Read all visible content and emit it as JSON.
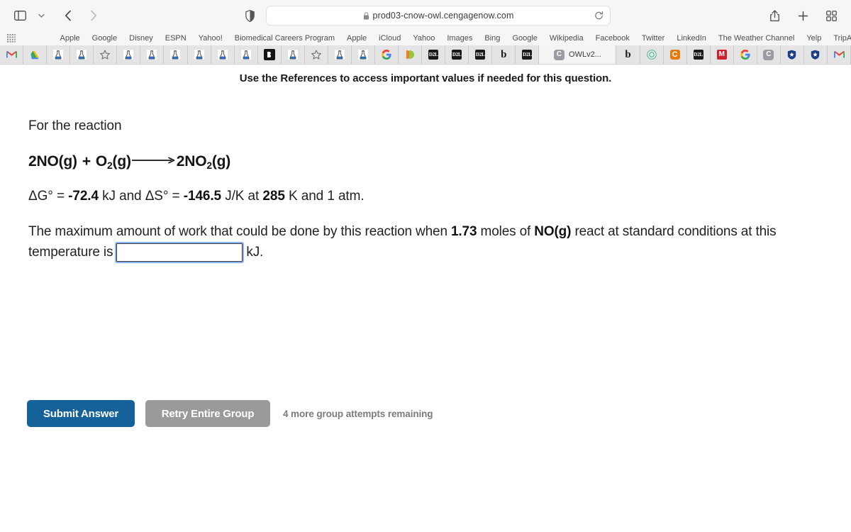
{
  "browser": {
    "toolbar": {
      "sidebar_toggle": "sidebar-toggle",
      "sidebar_chevron": "chevron-down",
      "back": "back-arrow",
      "forward": "forward-arrow",
      "shield": "privacy-shield",
      "url": "prod03-cnow-owl.cengagenow.com",
      "lock": "lock-icon",
      "reload": "reload-icon",
      "share": "share-icon",
      "new_tab": "plus-icon",
      "tab_overview": "tab-overview-icon"
    },
    "bookmarks": [
      "Apple",
      "Google",
      "Disney",
      "ESPN",
      "Yahoo!",
      "Biomedical Careers Program",
      "Apple",
      "iCloud",
      "Yahoo",
      "Images",
      "Bing",
      "Google",
      "Wikipedia",
      "Facebook",
      "Twitter",
      "LinkedIn",
      "The Weather Channel",
      "Yelp",
      "TripAdvisor"
    ],
    "tabs": [
      {
        "icon": "gmail-icon",
        "kind": "gmail",
        "label": "",
        "active": false
      },
      {
        "icon": "google-drive-icon",
        "kind": "drive",
        "label": "",
        "active": false
      },
      {
        "icon": "flask-icon",
        "kind": "flask",
        "label": "",
        "active": false
      },
      {
        "icon": "flask-icon",
        "kind": "flask",
        "label": "",
        "active": false
      },
      {
        "icon": "star-icon",
        "kind": "star",
        "label": "",
        "active": false
      },
      {
        "icon": "flask-icon",
        "kind": "flask",
        "label": "",
        "active": false
      },
      {
        "icon": "flask-icon",
        "kind": "flask",
        "label": "",
        "active": false
      },
      {
        "icon": "flask-icon",
        "kind": "flask",
        "label": "",
        "active": false
      },
      {
        "icon": "flask-icon",
        "kind": "flask",
        "label": "",
        "active": false
      },
      {
        "icon": "flask-icon",
        "kind": "flask",
        "label": "",
        "active": false
      },
      {
        "icon": "flask-icon",
        "kind": "flask",
        "label": "",
        "active": false
      },
      {
        "icon": "blackboard-icon",
        "kind": "blackboard",
        "label": "",
        "active": false
      },
      {
        "icon": "flask-icon",
        "kind": "flask",
        "label": "",
        "active": false
      },
      {
        "icon": "star-icon",
        "kind": "star",
        "label": "",
        "active": false
      },
      {
        "icon": "flask-icon",
        "kind": "flask",
        "label": "",
        "active": false
      },
      {
        "icon": "flask-icon",
        "kind": "flask",
        "label": "",
        "active": false
      },
      {
        "icon": "google-icon",
        "kind": "google",
        "label": "",
        "active": false
      },
      {
        "icon": "brightspace-icon",
        "kind": "brightspace",
        "label": "",
        "active": false
      },
      {
        "icon": "d2l-icon",
        "kind": "d2l",
        "label": "",
        "active": false
      },
      {
        "icon": "d2l-icon",
        "kind": "d2l",
        "label": "",
        "active": false
      },
      {
        "icon": "d2l-icon",
        "kind": "d2l",
        "label": "",
        "active": false
      },
      {
        "icon": "blackboard-b-icon",
        "kind": "b",
        "label": "",
        "active": false
      },
      {
        "icon": "d2l-icon",
        "kind": "d2l",
        "label": "",
        "active": false
      },
      {
        "icon": "cengage-icon",
        "kind": "cengage",
        "label": "OWLv2...",
        "active": true
      },
      {
        "icon": "blackboard-b-icon",
        "kind": "b",
        "label": "",
        "active": false
      },
      {
        "icon": "teal-circle-icon",
        "kind": "teal",
        "label": "",
        "active": false
      },
      {
        "icon": "canvas-icon",
        "kind": "canvas",
        "label": "",
        "active": false
      },
      {
        "icon": "d2l-icon",
        "kind": "d2l",
        "label": "",
        "active": false
      },
      {
        "icon": "mcgraw-hill-icon",
        "kind": "mred",
        "label": "",
        "active": false
      },
      {
        "icon": "google-icon",
        "kind": "google",
        "label": "",
        "active": false
      },
      {
        "icon": "cengage-icon",
        "kind": "cengage-gray",
        "label": "",
        "active": false
      },
      {
        "icon": "shield-star-icon",
        "kind": "shield",
        "label": "",
        "active": false
      },
      {
        "icon": "shield-star-icon",
        "kind": "shield",
        "label": "",
        "active": false
      },
      {
        "icon": "gmail-icon",
        "kind": "gmail",
        "label": "",
        "active": false
      }
    ]
  },
  "page": {
    "reference_banner": "Use the References to access important values if needed for this question.",
    "intro": "For the reaction",
    "equation": {
      "reactant1_coeff": "2",
      "reactant1": "NO(g)",
      "plus": "+",
      "reactant2_formula": "O",
      "reactant2_sub": "2",
      "reactant2_state": "(g)",
      "product_coeff": "2",
      "product_formula": "NO",
      "product_sub": "2",
      "product_state": "(g)",
      "full_text": "2NO(g) + O2(g) ⟶ 2NO2(g)"
    },
    "thermo": {
      "delta_g_label": "ΔG° =",
      "delta_g_value": "-72.4",
      "delta_g_units": "kJ and",
      "delta_s_label": "ΔS° =",
      "delta_s_value": "-146.5",
      "delta_s_units": "J/K at",
      "temperature": "285",
      "temperature_units": "K and 1 atm."
    },
    "question": {
      "part1": "The maximum amount of work that could be done by this reaction when",
      "moles": "1.73",
      "part2": "moles of",
      "species": "NO(g)",
      "part3": "react at standard conditions at this temperature is",
      "input_value": "",
      "input_placeholder": "",
      "units": "kJ."
    },
    "buttons": {
      "submit": "Submit Answer",
      "retry": "Retry Entire Group",
      "attempts": "4 more group attempts remaining",
      "submit_color": "#15629b",
      "retry_color": "#9a9a9a"
    }
  }
}
